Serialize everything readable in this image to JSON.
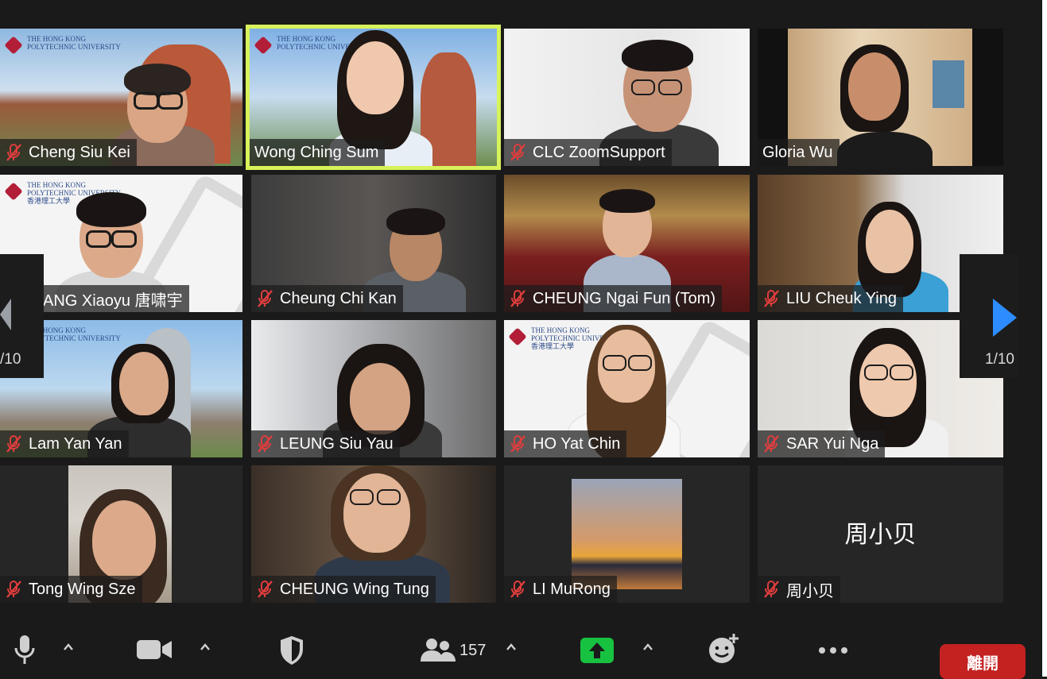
{
  "participants": [
    {
      "name": "Cheng Siu Kei"
    },
    {
      "name": "Wong Ching Sum"
    },
    {
      "name": "CLC ZoomSupport"
    },
    {
      "name": "Gloria Wu"
    },
    {
      "name": "ANG Xiaoyu 唐啸宇"
    },
    {
      "name": "Cheung Chi Kan"
    },
    {
      "name": "CHEUNG Ngai Fun (Tom)"
    },
    {
      "name": "LIU Cheuk Ying"
    },
    {
      "name": "Lam Yan Yan"
    },
    {
      "name": "LEUNG Siu Yau"
    },
    {
      "name": "HO Yat Chin"
    },
    {
      "name": "SAR Yui Nga"
    },
    {
      "name": "Tong Wing Sze"
    },
    {
      "name": "CHEUNG Wing Tung"
    },
    {
      "name": "LI MuRong"
    },
    {
      "name": "周小贝"
    }
  ],
  "no_video_name": "周小贝",
  "logo": {
    "line1": "THE HONG KONG",
    "line2": "POLYTECHNIC UNIVERSITY",
    "line3": "香港理工大學"
  },
  "pager": {
    "left": "/10",
    "right": "1/10"
  },
  "toolbar": {
    "participants_count": "157",
    "leave_label": "離開"
  },
  "colors": {
    "active_speaker": "#d7f25a",
    "leave": "#c42121",
    "share": "#18c241",
    "mic_muted": "#e03d3d",
    "nav_arrow": "#2d8cff"
  }
}
